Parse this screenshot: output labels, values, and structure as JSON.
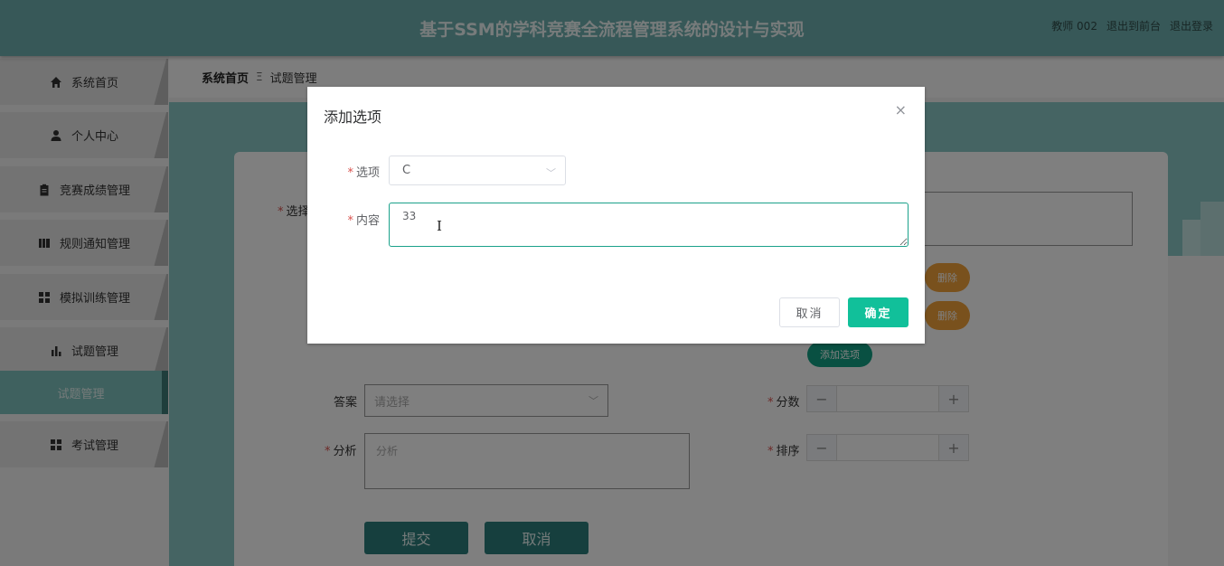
{
  "header": {
    "title": "基于SSM的学科竞赛全流程管理系统的设计与实现",
    "user": "教师 002",
    "to_front": "退出到前台",
    "logout": "退出登录"
  },
  "sidebar": {
    "items": [
      {
        "label": "系统首页",
        "icon": "home-icon"
      },
      {
        "label": "个人中心",
        "icon": "user-icon"
      },
      {
        "label": "竞赛成绩管理",
        "icon": "clipboard-icon"
      },
      {
        "label": "规则通知管理",
        "icon": "book-icon"
      },
      {
        "label": "模拟训练管理",
        "icon": "grid-icon"
      },
      {
        "label": "试题管理",
        "icon": "bar-chart-icon"
      },
      {
        "label": "考试管理",
        "icon": "grid-icon"
      }
    ],
    "active_sub": "试题管理"
  },
  "breadcrumb": {
    "home": "系统首页",
    "separator": "Ξ",
    "current": "试题管理"
  },
  "form": {
    "choice_label_partial": "选择",
    "delete_label": "删除",
    "add_option_label": "添加选项",
    "answer_label": "答案",
    "answer_placeholder": "请选择",
    "score_label": "分数",
    "analysis_label": "分析",
    "analysis_placeholder": "分析",
    "sort_label": "排序",
    "stepper_minus": "−",
    "stepper_plus": "+",
    "submit_label": "提交",
    "cancel_label": "取消"
  },
  "dialog": {
    "title": "添加选项",
    "close": "×",
    "option_label": "选项",
    "option_value": "C",
    "content_label": "内容",
    "content_value": "33",
    "cancel_label": "取消",
    "confirm_label": "确定"
  },
  "colors": {
    "header": "#6fb1b0",
    "content": "#8ac9c6",
    "primary": "#11c09a",
    "delete": "#f3a23b",
    "add": "#12a184"
  }
}
